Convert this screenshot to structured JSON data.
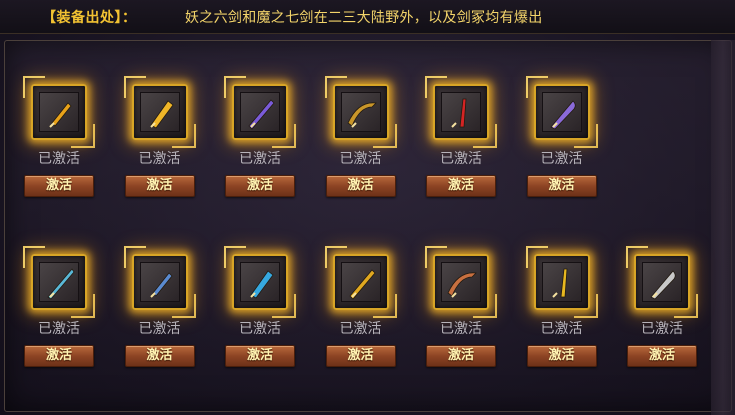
{
  "header": {
    "source_label": "【装备出处】：",
    "source_text": "妖之六剑和魔之七剑在二三大陆野外，以及剑冢均有爆出"
  },
  "rows": [
    {
      "items": [
        {
          "icon": "golden-dagger-icon",
          "color": "#e8a21a",
          "status": "已激活",
          "button": "激活"
        },
        {
          "icon": "golden-blade-icon",
          "color": "#f0b628",
          "status": "已激活",
          "button": "激活"
        },
        {
          "icon": "purple-sword-icon",
          "color": "#7a5bd8",
          "status": "已激活",
          "button": "激活"
        },
        {
          "icon": "dragon-saber-icon",
          "color": "#c9962a",
          "status": "已激活",
          "button": "激活"
        },
        {
          "icon": "red-blade-icon",
          "color": "#d42424",
          "status": "已激活",
          "button": "激活"
        },
        {
          "icon": "purple-scimitar-icon",
          "color": "#8a6ad8",
          "status": "已激活",
          "button": "激活"
        }
      ]
    },
    {
      "items": [
        {
          "icon": "ice-greatsword-icon",
          "color": "#5ab8d8",
          "status": "已激活",
          "button": "激活"
        },
        {
          "icon": "blue-longsword-icon",
          "color": "#5a8ad0",
          "status": "已激活",
          "button": "激活"
        },
        {
          "icon": "cyan-dagger-icon",
          "color": "#36a8e0",
          "status": "已激活",
          "button": "激活"
        },
        {
          "icon": "golden-rod-icon",
          "color": "#e0a820",
          "status": "已激活",
          "button": "激活"
        },
        {
          "icon": "twisted-blade-icon",
          "color": "#c87040",
          "status": "已激活",
          "button": "激活"
        },
        {
          "icon": "golden-spear-icon",
          "color": "#e8b820",
          "status": "已激活",
          "button": "激活"
        },
        {
          "icon": "serrated-blade-icon",
          "color": "#c8c8c8",
          "status": "已激活",
          "button": "激活"
        }
      ]
    }
  ]
}
